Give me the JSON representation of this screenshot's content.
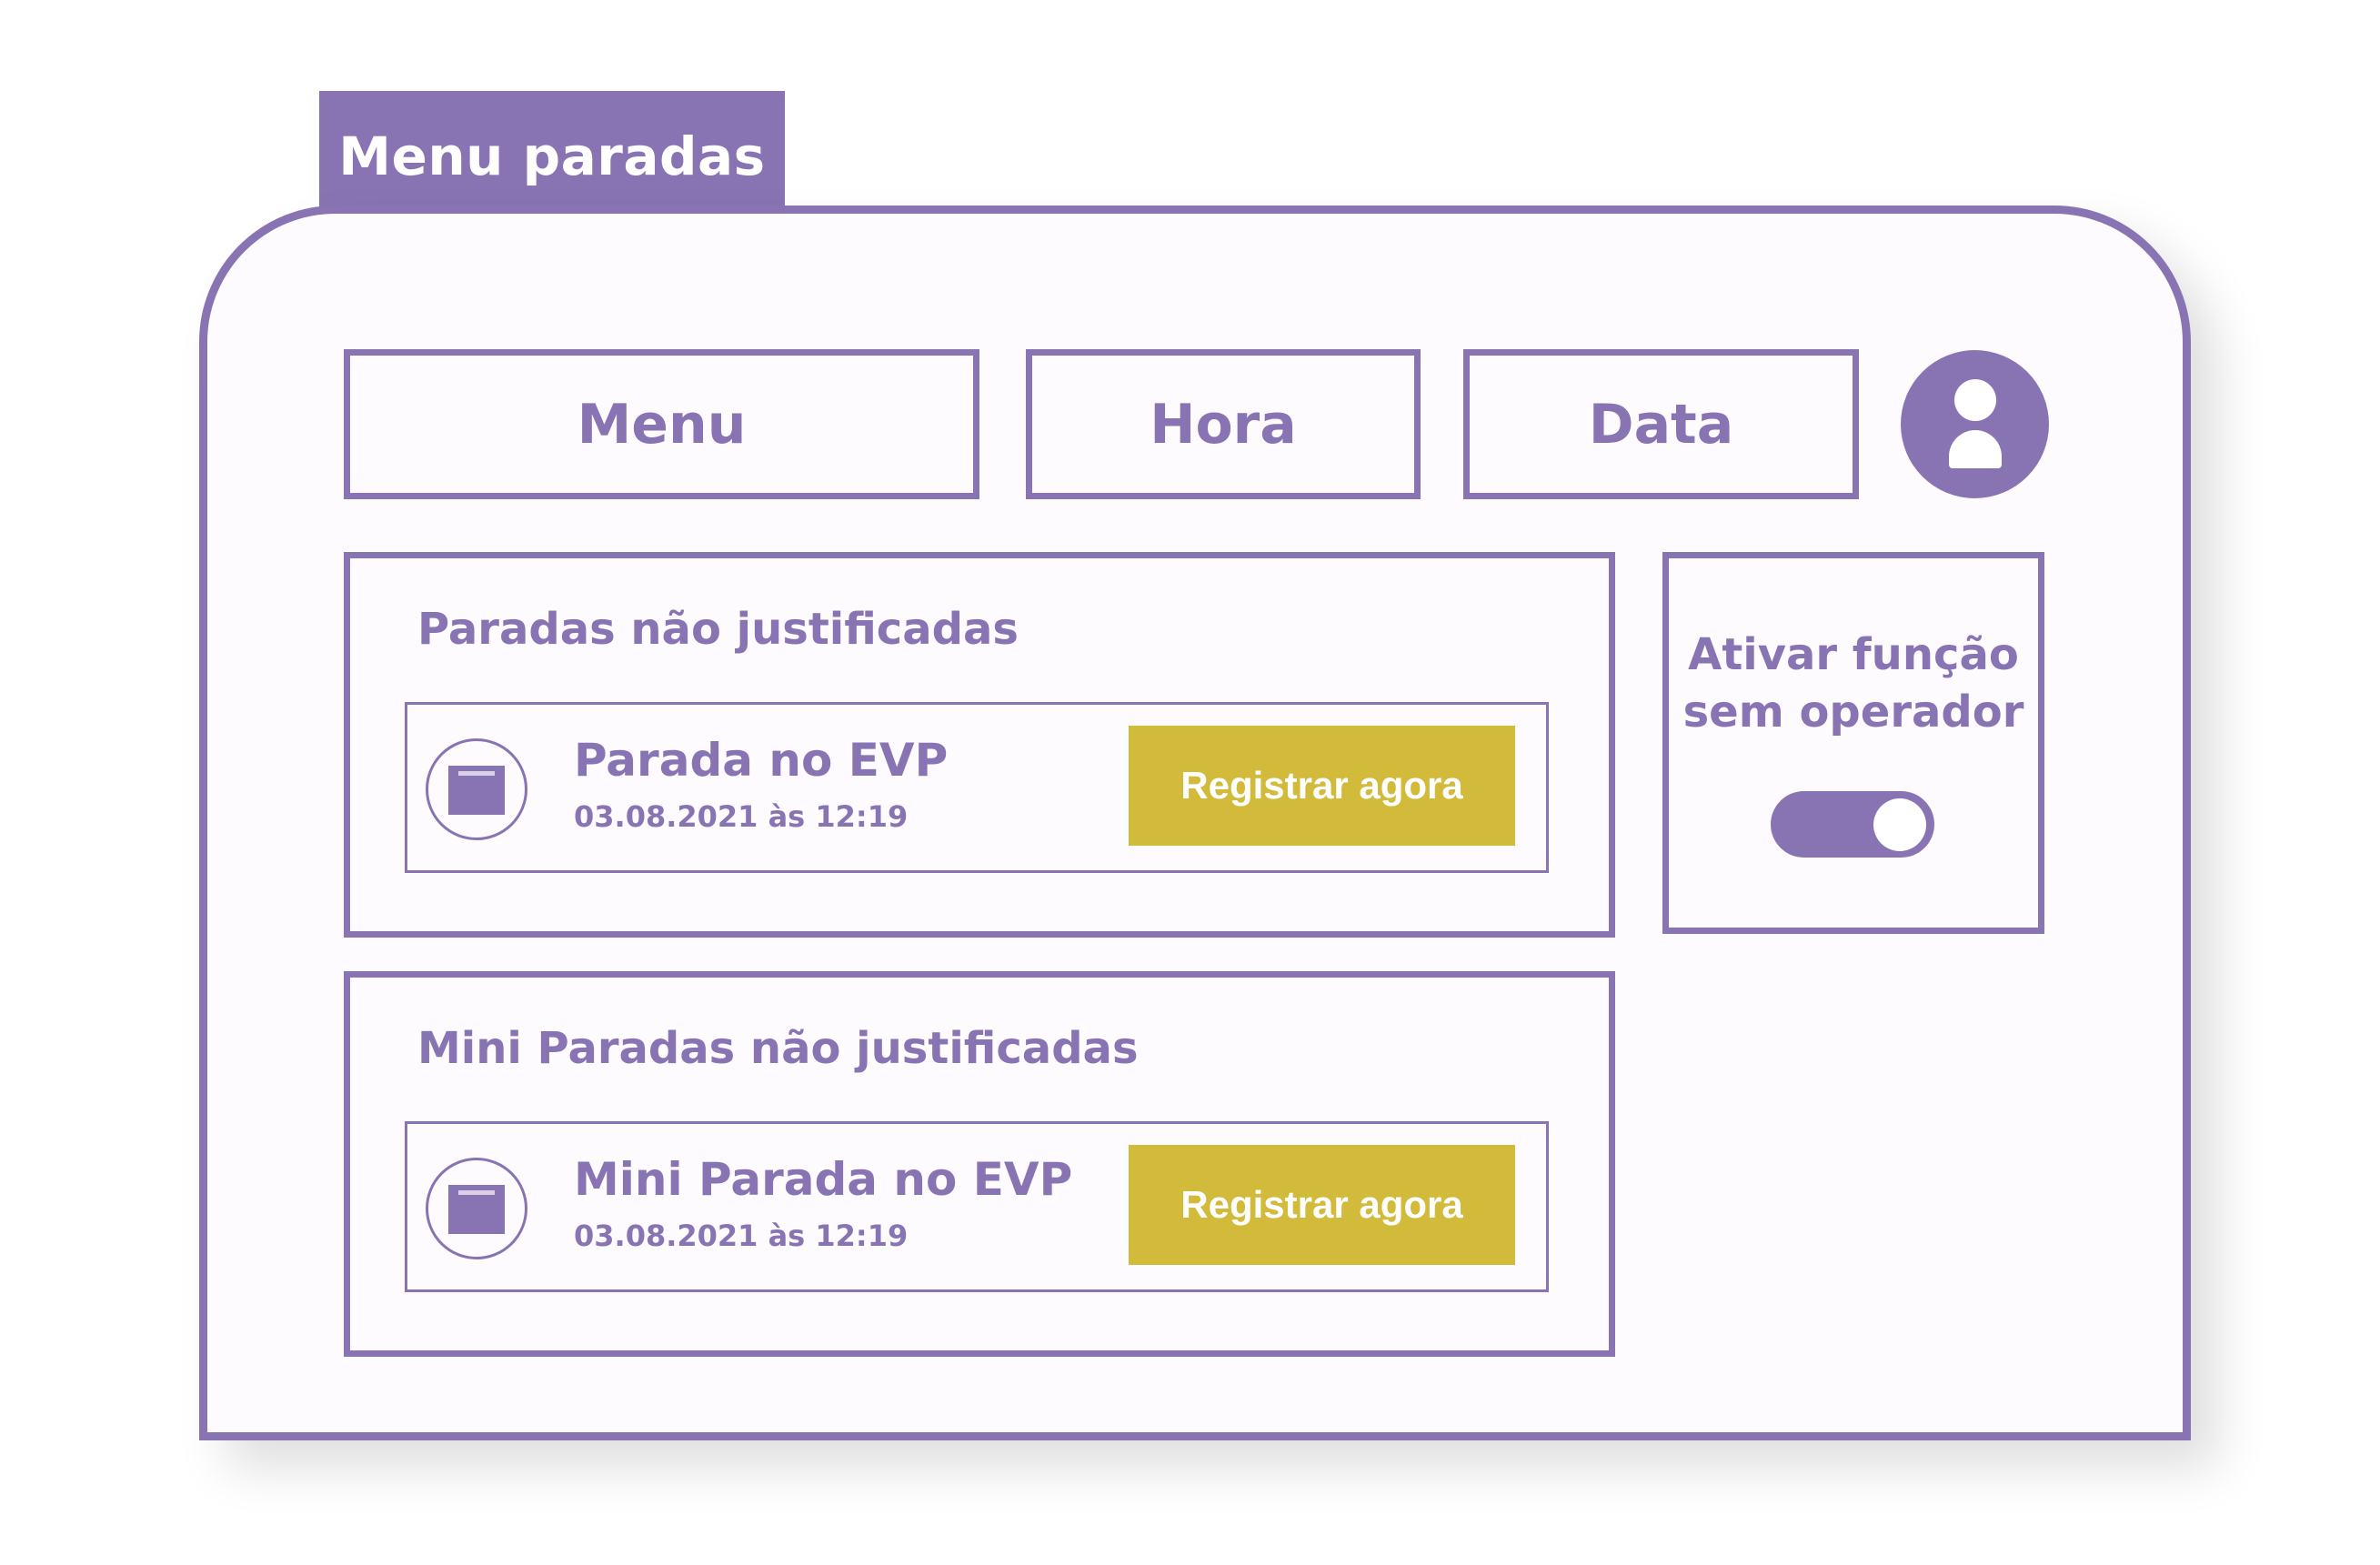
{
  "window_tab": {
    "title": "Menu paradas"
  },
  "nav": {
    "menu_label": "Menu",
    "hora_label": "Hora",
    "data_label": "Data",
    "avatar_icon": "user-icon"
  },
  "paradas_panel": {
    "title": "Paradas não justificadas",
    "item": {
      "icon": "box-icon",
      "title": "Parada no EVP",
      "timestamp": "03.08.2021 às 12:19",
      "button_label": "Registrar agora"
    }
  },
  "mini_paradas_panel": {
    "title": "Mini Paradas não justificadas",
    "item": {
      "icon": "box-icon",
      "title": "Mini Parada no EVP",
      "timestamp": "03.08.2021 às 12:19",
      "button_label": "Registrar agora"
    }
  },
  "operator_panel": {
    "label_line1": "Ativar função",
    "label_line2": "sem operador",
    "toggle_on": true
  },
  "colors": {
    "accent": "#8874b3",
    "button": "#d2bb3b",
    "background": "#fdfbfd"
  }
}
